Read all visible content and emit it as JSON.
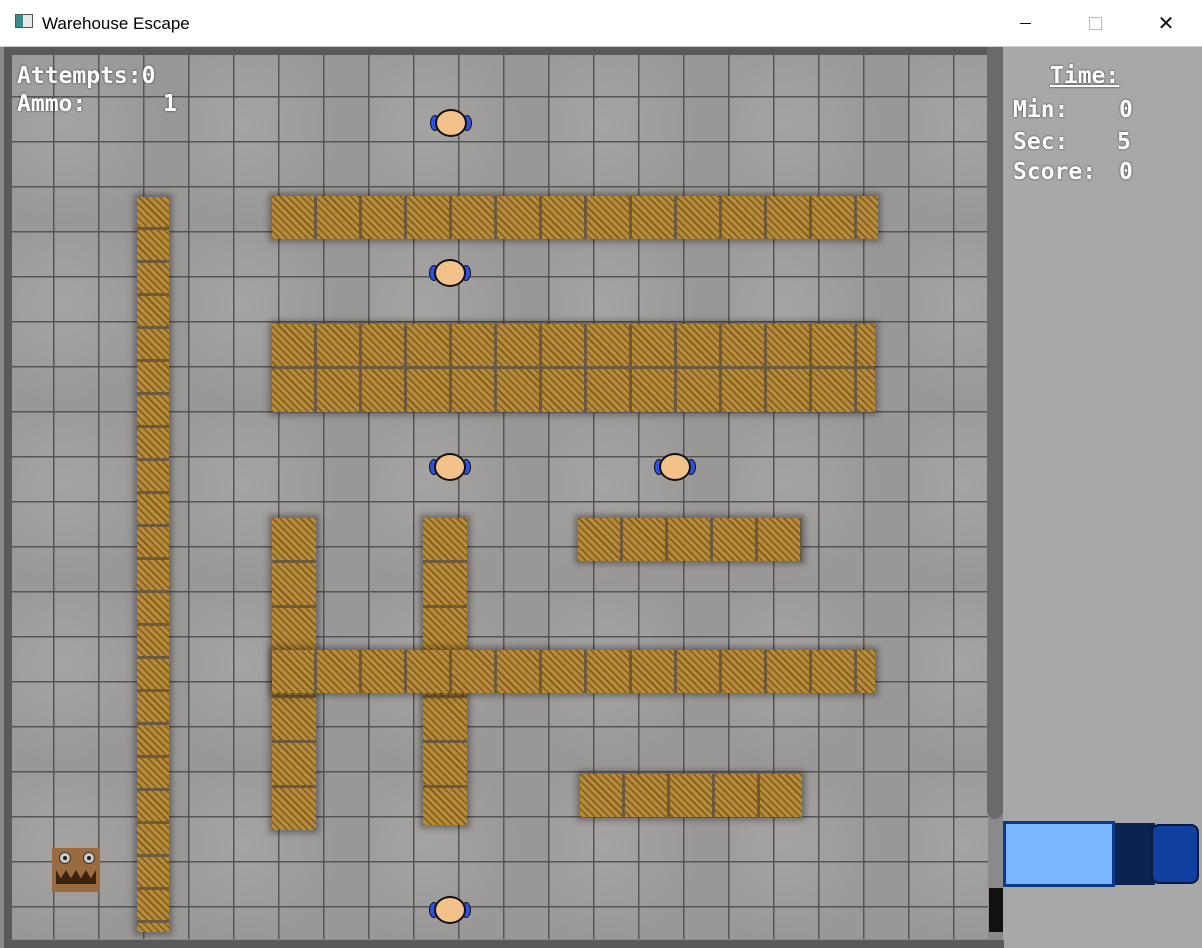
{
  "window": {
    "title": "Warehouse Escape",
    "minimize_glyph": "",
    "maximize_glyph": "",
    "close_glyph": "✕"
  },
  "hud": {
    "attempts_label": "Attempts:",
    "attempts_value": "0",
    "ammo_label": "Ammo:",
    "ammo_value": "1",
    "time_label": "Time:",
    "min_label": "Min:",
    "min_value": "0",
    "sec_label": "Sec:",
    "sec_value": "5",
    "score_label": "Score:",
    "score_value": "0"
  },
  "colors": {
    "crate": "#b68b3a",
    "guard_head": "#f2c28a",
    "guard_arm": "#3050e0",
    "truck_trailer": "#7ab6ff",
    "truck_cab": "#1040a0",
    "floor": "#9a9896"
  },
  "icons": {
    "app": "window-app-icon",
    "guard": "guard-topdown-icon",
    "player": "cardboard-box-monster-icon",
    "truck": "escape-truck-icon"
  }
}
